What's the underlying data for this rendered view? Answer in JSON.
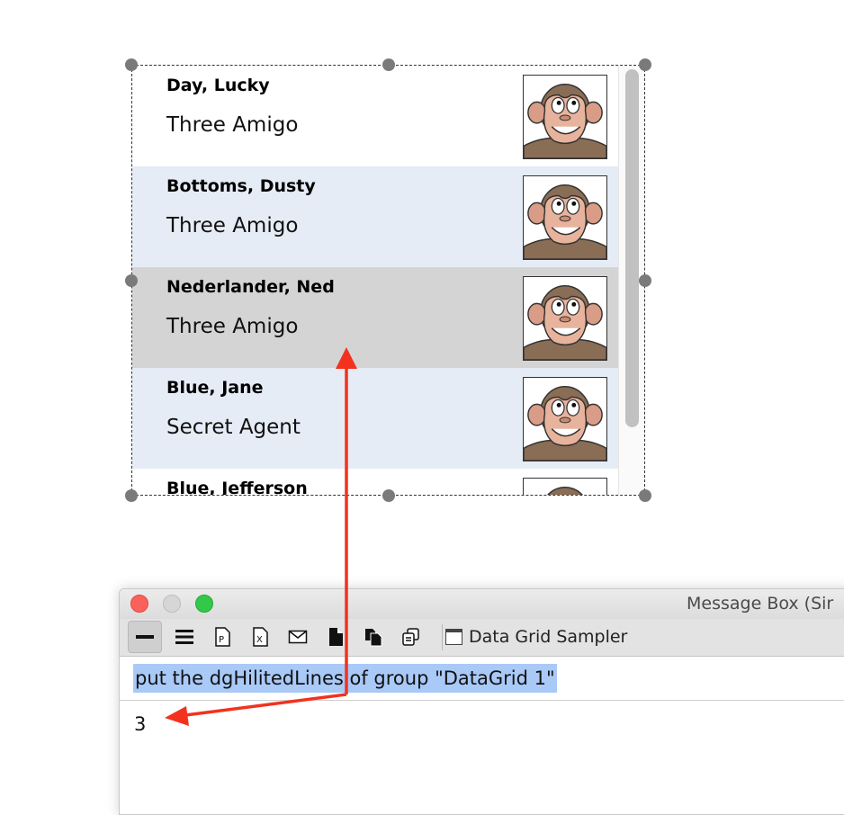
{
  "datagrid": {
    "rows": [
      {
        "name": "Day, Lucky",
        "title": "Three Amigo",
        "style": "normal"
      },
      {
        "name": "Bottoms, Dusty",
        "title": "Three Amigo",
        "style": "alt"
      },
      {
        "name": "Nederlander, Ned",
        "title": "Three Amigo",
        "style": "hilite"
      },
      {
        "name": "Blue, Jane",
        "title": "Secret Agent",
        "style": "alt"
      },
      {
        "name": "Blue, Jefferson",
        "title": "",
        "style": "normal"
      }
    ],
    "picture_icon": "monkey-portrait-icon",
    "colors": {
      "alt_row": "#e6ecf6",
      "hilite_row": "#d4d4d4"
    }
  },
  "message_box": {
    "window_title": "Message Box (Sir",
    "toolbar": {
      "buttons": [
        {
          "icon": "single-line-icon"
        },
        {
          "icon": "multi-line-icon"
        },
        {
          "icon": "pending-messages-icon"
        },
        {
          "icon": "frontscripts-icon"
        },
        {
          "icon": "message-icon"
        },
        {
          "icon": "document-icon"
        },
        {
          "icon": "copy-stack-icon"
        },
        {
          "icon": "paste-stack-icon"
        }
      ],
      "stack_label": "Data Grid Sampler"
    },
    "command": "put the dgHilitedLines of group \"DataGrid 1\"",
    "result": "3"
  },
  "annotation_color": "#f2321e"
}
